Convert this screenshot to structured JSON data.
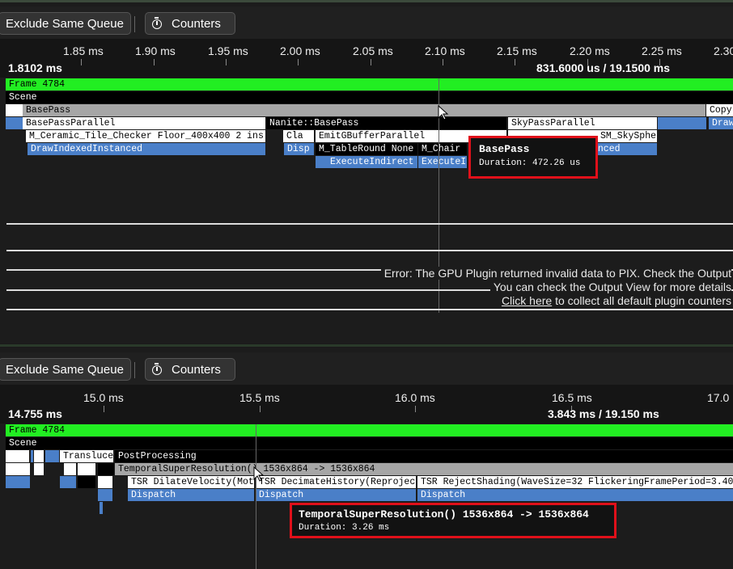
{
  "top": {
    "toolbar": {
      "exclude_label": "Exclude Same Queue",
      "counters_label": "Counters"
    },
    "ruler": {
      "ticks": [
        "1.85 ms",
        "1.90 ms",
        "1.95 ms",
        "2.00 ms",
        "2.05 ms",
        "2.10 ms",
        "2.15 ms",
        "2.20 ms",
        "2.25 ms",
        "2.30"
      ],
      "range_start": "1.8102 ms",
      "range_span": "831.6000 us / 19.1500 ms"
    },
    "frame_label": "Frame 4784",
    "scene_label": "Scene",
    "basepass_label": "BasePass",
    "copy_label": "Copy",
    "basepass_parallel_label": "BasePassParallel",
    "nanite_label": "Nanite::BasePass",
    "skypass_label": "SkyPassParallel",
    "draw_label": "Draw",
    "ceramic_label": "M_Ceramic_Tile_Checker Floor_400x400 2 ins",
    "cla_label": "Cla",
    "emit_label": "EmitGBufferParallel",
    "skysphere_label": "SM_SkySphe",
    "dii_label": "DrawIndexedInstanced",
    "disp_label": "Disp",
    "table_label": "M_TableRound None",
    "chair_label": "M_Chair",
    "anced_label": "anced",
    "exec1_label": "ExecuteIndirect",
    "exec2_label": "ExecuteI",
    "tooltip": {
      "title": "BasePass",
      "duration": "Duration: 472.26 us"
    },
    "error_line1": "Error: The GPU Plugin returned invalid data to PIX. Check the Output",
    "error_line2": "You can check the Output View for more details",
    "click_here": "Click here",
    "collect_text": " to collect all default plugin counters"
  },
  "bottom": {
    "toolbar": {
      "exclude_label": "Exclude Same Queue",
      "counters_label": "Counters"
    },
    "ruler": {
      "ticks": [
        "15.0 ms",
        "15.5 ms",
        "16.0 ms",
        "16.5 ms",
        "17.0"
      ],
      "range_start": "14.755 ms",
      "range_span": "3.843 ms / 19.150 ms"
    },
    "frame_label": "Frame 4784",
    "scene_label": "Scene",
    "transluc_label": "Transluce",
    "postproc_label": "PostProcessing",
    "tsr_label": "TemporalSuperResolution() 1536x864 -> 1536x864",
    "dilate_label": "TSR DilateVelocity(Mot",
    "decimate_label": "TSR DecimateHistory(Reprojec",
    "reject_label": "TSR RejectShading(WaveSize=32 FlickeringFramePeriod=3.40",
    "dispatch_label": "Dispatch",
    "tooltip": {
      "title": "TemporalSuperResolution() 1536x864 -> 1536x864",
      "duration": "Duration: 3.26 ms"
    }
  }
}
